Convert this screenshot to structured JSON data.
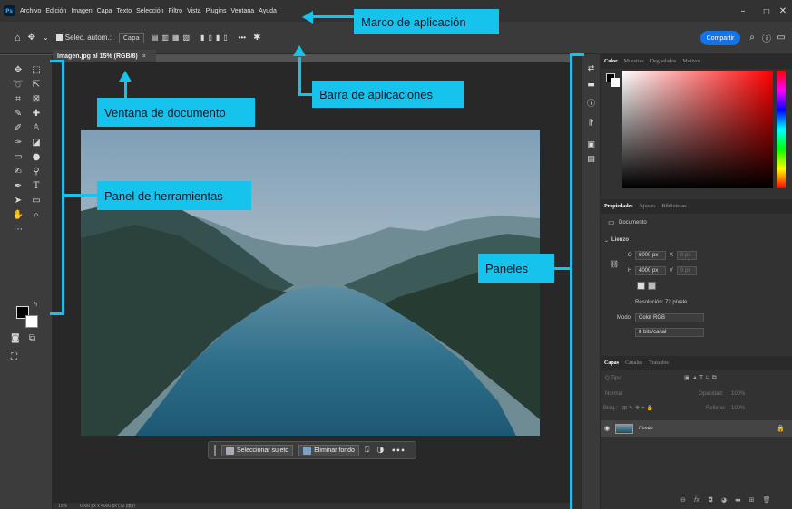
{
  "app": {
    "menu": [
      "Archivo",
      "Edición",
      "Imagen",
      "Capa",
      "Texto",
      "Selección",
      "Filtro",
      "Vista",
      "Plugins",
      "Ventana",
      "Ayuda"
    ],
    "logo": "Ps",
    "window_controls": {
      "minimize": "–",
      "maximize": "□",
      "close": "✕"
    }
  },
  "options": {
    "auto_select_label": "Selec. autom.:",
    "auto_select_value": "Capa",
    "more": "•••",
    "share_label": "Compartir"
  },
  "document": {
    "tab_title": "Imagen.jpg al 15% (RGB/8)",
    "tab_close": "×",
    "status_zoom": "15%",
    "status_info": "6000 px x 4000 px (72 ppp)"
  },
  "context_bar": {
    "select_subject": "Seleccionar sujeto",
    "remove_bg": "Eliminar fondo",
    "more": "•••"
  },
  "color_panel": {
    "tabs": [
      "Color",
      "Muestras",
      "Degradados",
      "Motivos"
    ]
  },
  "properties_panel": {
    "tabs": [
      "Propiedades",
      "Ajustes",
      "Bibliotecas"
    ],
    "doc_label": "Documento",
    "section": "Lienzo",
    "w_label": "O",
    "w_value": "6000 px",
    "h_label": "H",
    "h_value": "4000 px",
    "x_label": "X",
    "x_value": "0 px",
    "y_label": "Y",
    "y_value": "0 px",
    "resolution": "Resolución: 72 píxele",
    "mode_label": "Modo",
    "mode_value": "Color RGB",
    "depth_value": "8 bits/canal"
  },
  "layers_panel": {
    "tabs": [
      "Capas",
      "Canales",
      "Trazados"
    ],
    "search_placeholder": "Q Tipo",
    "blend": "Normal",
    "opacity_label": "Opacidad:",
    "opacity_value": "100%",
    "lock_label": "Bloq.:",
    "fill_label": "Relleno:",
    "fill_value": "100%",
    "layer_name": "Fondo"
  },
  "callouts": {
    "app_frame": "Marco de aplicación",
    "app_bar": "Barra de aplicaciones",
    "doc_window": "Ventana de documento",
    "tools_panel": "Panel de herramientas",
    "panels": "Paneles"
  },
  "colors": {
    "accent": "#16c3ec",
    "share": "#1473e6"
  }
}
